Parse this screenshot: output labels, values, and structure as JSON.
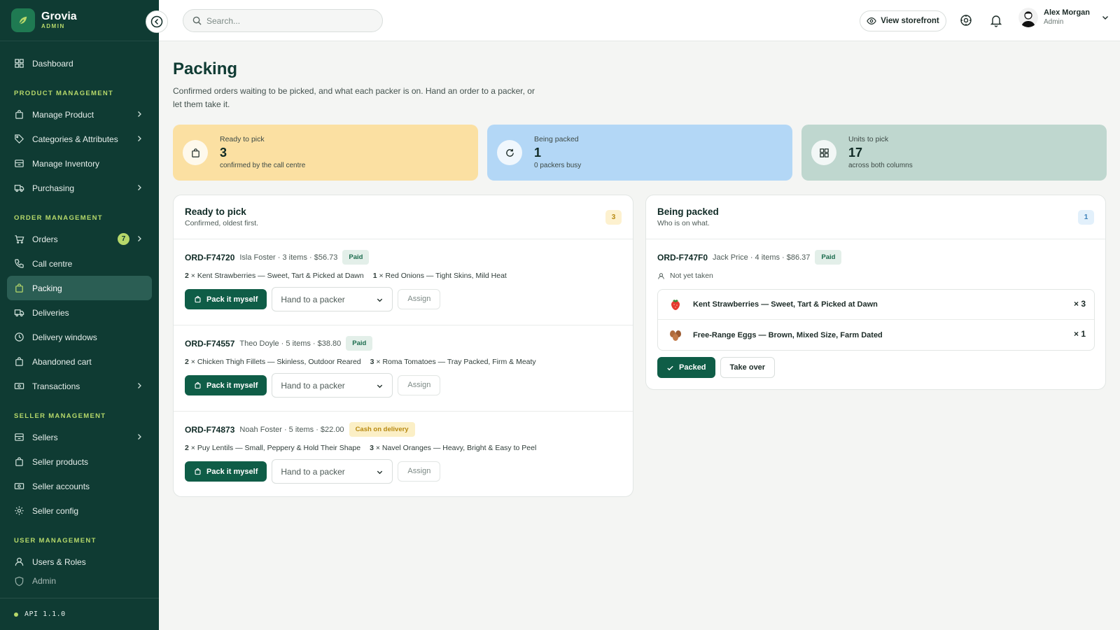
{
  "brand": {
    "name": "Grovia",
    "sub": "ADMIN"
  },
  "sidebar": {
    "sections": [
      {
        "items": [
          {
            "label": "Dashboard",
            "icon": "grid-icon"
          }
        ]
      },
      {
        "title": "PRODUCT MANAGEMENT",
        "items": [
          {
            "label": "Manage Product",
            "icon": "bag-icon",
            "chevron": true
          },
          {
            "label": "Categories & Attributes",
            "icon": "tag-icon",
            "chevron": true
          },
          {
            "label": "Manage Inventory",
            "icon": "inventory-icon"
          },
          {
            "label": "Purchasing",
            "icon": "truck-icon",
            "chevron": true
          }
        ]
      },
      {
        "title": "ORDER MANAGEMENT",
        "items": [
          {
            "label": "Orders",
            "icon": "cart-icon",
            "chevron": true,
            "count": "7"
          },
          {
            "label": "Call centre",
            "icon": "phone-icon"
          },
          {
            "label": "Packing",
            "icon": "bag-icon",
            "active": true
          },
          {
            "label": "Deliveries",
            "icon": "truck-icon"
          },
          {
            "label": "Delivery windows",
            "icon": "clock-icon"
          },
          {
            "label": "Abandoned cart",
            "icon": "bag-icon"
          },
          {
            "label": "Transactions",
            "icon": "cash-icon",
            "chevron": true
          }
        ]
      },
      {
        "title": "SELLER MANAGEMENT",
        "items": [
          {
            "label": "Sellers",
            "icon": "inventory-icon",
            "chevron": true
          },
          {
            "label": "Seller products",
            "icon": "bag-icon"
          },
          {
            "label": "Seller accounts",
            "icon": "cash-icon"
          },
          {
            "label": "Seller config",
            "icon": "gear-icon"
          }
        ]
      },
      {
        "title": "USER MANAGEMENT",
        "items": [
          {
            "label": "Users & Roles",
            "icon": "user-icon"
          },
          {
            "label": "Admin",
            "icon": "shield-icon",
            "faded": true
          }
        ]
      }
    ],
    "footer": "API 1.1.0"
  },
  "topbar": {
    "search_placeholder": "Search...",
    "storefront_label": "View storefront",
    "user": {
      "name": "Alex Morgan",
      "role": "Admin"
    }
  },
  "page": {
    "title": "Packing",
    "description": "Confirmed orders waiting to be picked, and what each packer is on. Hand an order to a packer, or let them take it."
  },
  "stats": [
    {
      "label": "Ready to pick",
      "value": "3",
      "sub": "confirmed by the call centre",
      "icon": "bag-icon",
      "color": "#fbe0a2"
    },
    {
      "label": "Being packed",
      "value": "1",
      "sub": "0 packers busy",
      "icon": "refresh-icon",
      "color": "#b3d7f6"
    },
    {
      "label": "Units to pick",
      "value": "17",
      "sub": "across both columns",
      "icon": "grid-icon",
      "color": "#bfd7cf"
    }
  ],
  "ready": {
    "title": "Ready to pick",
    "subtitle": "Confirmed, oldest first.",
    "count": "3",
    "orders": [
      {
        "id": "ORD-F74720",
        "meta": "Isla Foster · 3 items · $56.73",
        "badge": "Paid",
        "badge_type": "paid",
        "items": [
          {
            "qty": "2",
            "name": "Kent Strawberries — Sweet, Tart & Picked at Dawn"
          },
          {
            "qty": "1",
            "name": "Red Onions — Tight Skins, Mild Heat"
          }
        ]
      },
      {
        "id": "ORD-F74557",
        "meta": "Theo Doyle · 5 items · $38.80",
        "badge": "Paid",
        "badge_type": "paid",
        "items": [
          {
            "qty": "2",
            "name": "Chicken Thigh Fillets — Skinless, Outdoor Reared"
          },
          {
            "qty": "3",
            "name": "Roma Tomatoes — Tray Packed, Firm & Meaty"
          }
        ]
      },
      {
        "id": "ORD-F74873",
        "meta": "Noah Foster · 5 items · $22.00",
        "badge": "Cash on delivery",
        "badge_type": "cod",
        "items": [
          {
            "qty": "2",
            "name": "Puy Lentils — Small, Peppery & Hold Their Shape"
          },
          {
            "qty": "3",
            "name": "Navel Oranges — Heavy, Bright & Easy to Peel"
          }
        ]
      }
    ],
    "pack_label": "Pack it myself",
    "packer_placeholder": "Hand to a packer",
    "assign_label": "Assign"
  },
  "packing": {
    "title": "Being packed",
    "subtitle": "Who is on what.",
    "count": "1",
    "order": {
      "id": "ORD-F747F0",
      "meta": "Jack Price · 4 items · $86.37",
      "badge": "Paid",
      "status": "Not yet taken",
      "products": [
        {
          "name": "Kent Strawberries — Sweet, Tart & Picked at Dawn",
          "qty": "× 3",
          "thumb": "strawberry-icon"
        },
        {
          "name": "Free-Range Eggs — Brown, Mixed Size, Farm Dated",
          "qty": "× 1",
          "thumb": "eggs-icon"
        }
      ]
    },
    "packed_label": "Packed",
    "takeover_label": "Take over"
  }
}
